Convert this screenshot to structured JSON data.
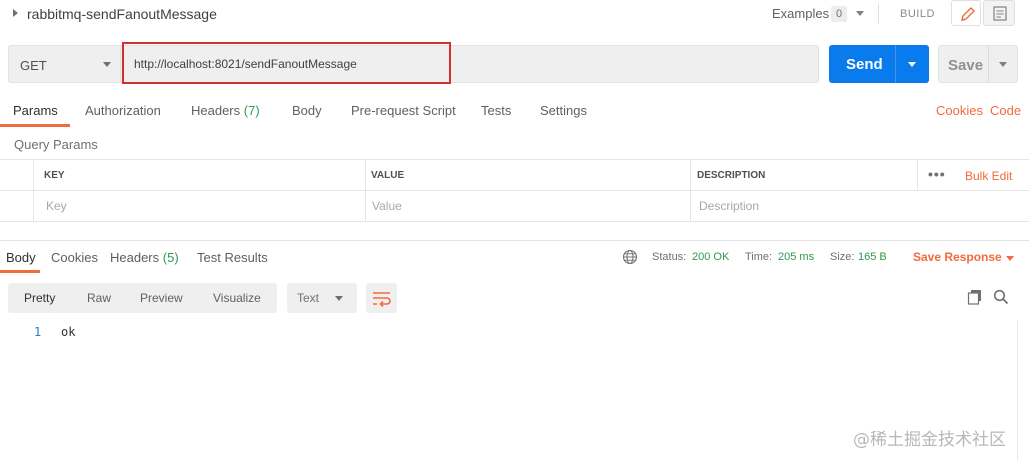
{
  "header": {
    "request_name": "rabbitmq-sendFanoutMessage",
    "examples_label": "Examples",
    "examples_count": "0",
    "build_label": "BUILD",
    "pencil_icon": "pencil-icon",
    "doc_icon": "comment-icon"
  },
  "request": {
    "method": "GET",
    "url": "http://localhost:8021/sendFanoutMessage",
    "send_label": "Send",
    "save_label": "Save",
    "highlight_color": "#d32f2f"
  },
  "request_tabs": [
    {
      "label": "Params",
      "active": true
    },
    {
      "label": "Authorization"
    },
    {
      "label": "Headers",
      "count": "(7)"
    },
    {
      "label": "Body"
    },
    {
      "label": "Pre-request Script"
    },
    {
      "label": "Tests"
    },
    {
      "label": "Settings"
    }
  ],
  "request_links": {
    "cookies": "Cookies",
    "code": "Code"
  },
  "query_params": {
    "title": "Query Params",
    "columns": [
      "KEY",
      "VALUE",
      "DESCRIPTION"
    ],
    "placeholders": [
      "Key",
      "Value",
      "Description"
    ],
    "bulk_edit": "Bulk Edit",
    "more": "•••"
  },
  "response_tabs": [
    {
      "label": "Body",
      "active": true
    },
    {
      "label": "Cookies"
    },
    {
      "label": "Headers",
      "count": "(5)"
    },
    {
      "label": "Test Results"
    }
  ],
  "response_status": {
    "status_label": "Status:",
    "status_value": "200 OK",
    "time_label": "Time:",
    "time_value": "205 ms",
    "size_label": "Size:",
    "size_value": "165 B",
    "save_response": "Save Response"
  },
  "response_view": {
    "formats": [
      "Pretty",
      "Raw",
      "Preview",
      "Visualize"
    ],
    "active_format": "Pretty",
    "type": "Text",
    "lines": [
      {
        "num": "1",
        "text": "ok"
      }
    ]
  },
  "watermark": "@稀土掘金技术社区",
  "colors": {
    "accent": "#f26b3a",
    "send_blue": "#097bed",
    "success": "#2f9a4f"
  }
}
